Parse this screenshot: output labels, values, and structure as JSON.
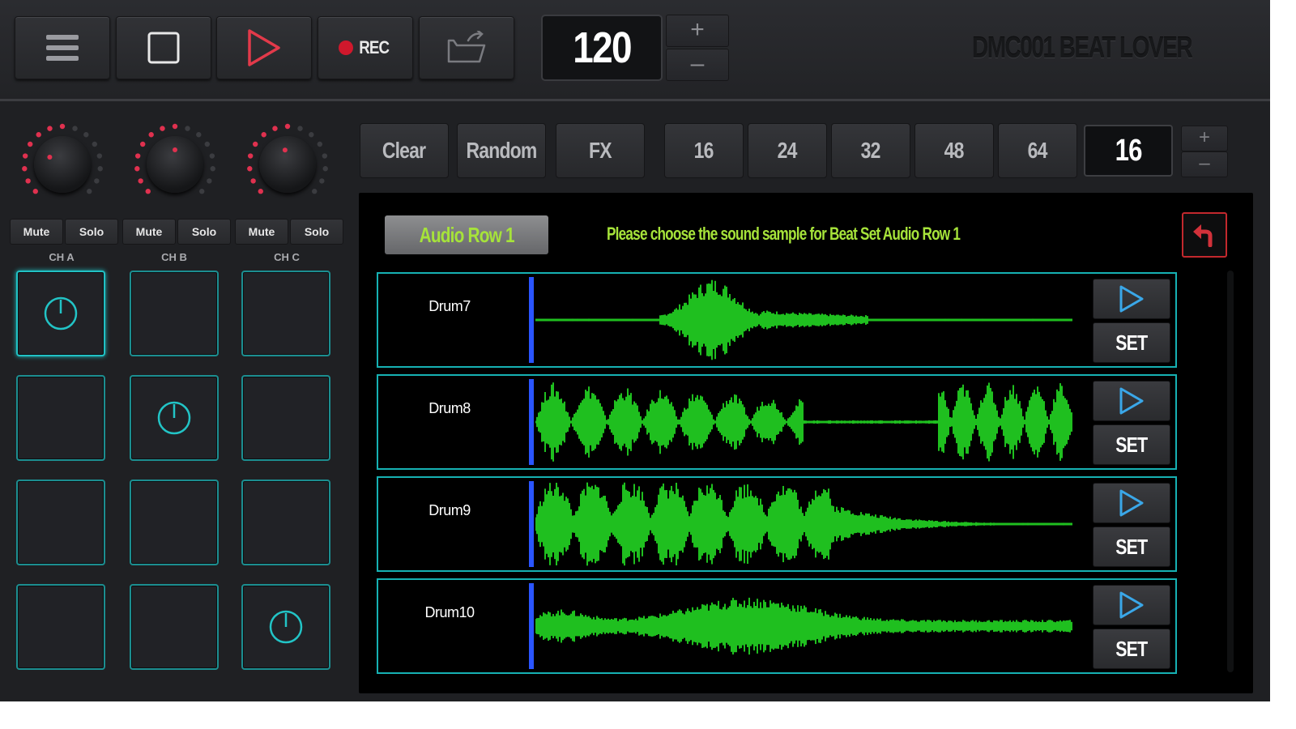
{
  "colors": {
    "accent_teal": "#16b1b3",
    "wave_green": "#1fbf1f",
    "label_green": "#a6e33a",
    "record_red": "#d0182c",
    "cursor_blue": "#2a55ff"
  },
  "toolbar": {
    "menu_icon": "menu-icon",
    "stop_icon": "stop-icon",
    "play_icon": "play-icon",
    "rec_label": "REC",
    "folder_icon": "folder-open-icon",
    "bpm": "120",
    "plus": "+",
    "minus": "–",
    "brand": "DMC001 BEAT LOVER"
  },
  "mixer": {
    "channels": [
      {
        "label": "CH A",
        "mute": "Mute",
        "solo": "Solo"
      },
      {
        "label": "CH B",
        "mute": "Mute",
        "solo": "Solo"
      },
      {
        "label": "CH C",
        "mute": "Mute",
        "solo": "Solo"
      }
    ],
    "active_pads": [
      [
        0,
        0
      ],
      [
        1,
        1
      ],
      [
        3,
        2
      ]
    ]
  },
  "sequencer": {
    "clear": "Clear",
    "random": "Random",
    "fx": "FX",
    "steps": [
      "16",
      "24",
      "32",
      "48",
      "64"
    ],
    "current_steps": "16",
    "plus": "+",
    "minus": "–"
  },
  "sample_panel": {
    "row_tab": "Audio Row 1",
    "hint": "Please choose the sound sample for Beat Set  Audio Row 1",
    "back_icon": "undo-arrow-icon",
    "samples": [
      {
        "name": "Drum7",
        "set": "SET"
      },
      {
        "name": "Drum8",
        "set": "SET"
      },
      {
        "name": "Drum9",
        "set": "SET"
      },
      {
        "name": "Drum10",
        "set": "SET"
      }
    ]
  }
}
